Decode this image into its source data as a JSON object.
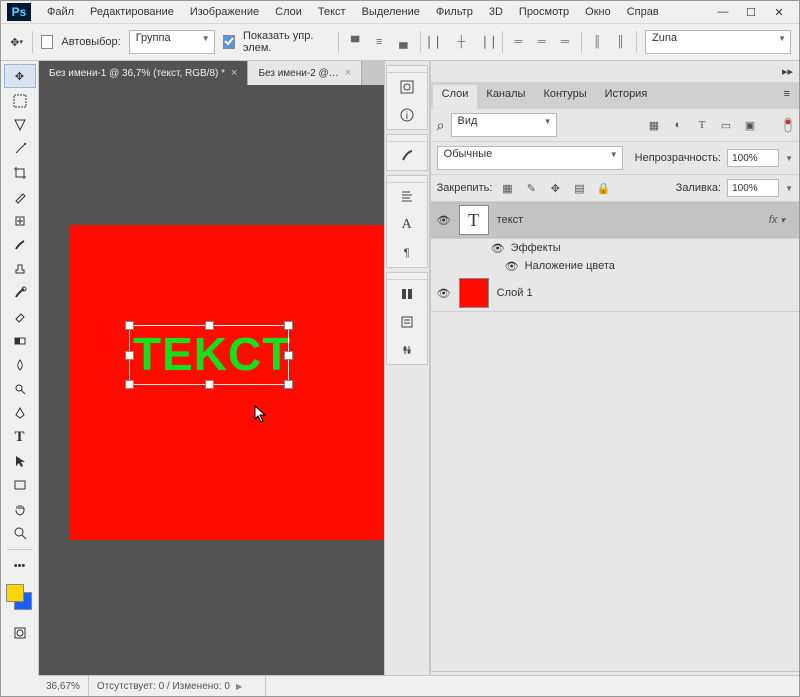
{
  "menu": [
    "Файл",
    "Редактирование",
    "Изображение",
    "Слои",
    "Текст",
    "Выделение",
    "Фильтр",
    "3D",
    "Просмотр",
    "Окно",
    "Справ"
  ],
  "options": {
    "autoselect_label": "Автовыбор:",
    "autoselect_mode": "Группа",
    "show_controls_label": "Показать упр. элем.",
    "font_preset": "Zuna"
  },
  "tabs": [
    {
      "label": "Без имени-1 @ 36,7% (текст, RGB/8) *",
      "active": true
    },
    {
      "label": "Без имени-2 @…",
      "active": false
    }
  ],
  "canvas": {
    "bg_color": "#ff0b00",
    "text": "TEKCT",
    "text_color": "#15e01b"
  },
  "status": {
    "zoom": "36,67%",
    "info": "Отсутствует: 0 / Изменено: 0"
  },
  "panel": {
    "tabs": [
      "Слои",
      "Каналы",
      "Контуры",
      "История"
    ],
    "filter_kind": "Вид",
    "blend_mode": "Обычные",
    "opacity_label": "Непрозрачность:",
    "opacity_value": "100%",
    "lock_label": "Закрепить:",
    "fill_label": "Заливка:",
    "fill_value": "100%",
    "layers": [
      {
        "name": "текст",
        "type": "text",
        "selected": true,
        "fx": [
          "Эффекты",
          "Наложение цвета"
        ]
      },
      {
        "name": "Слой 1",
        "type": "raster",
        "color": "#ff0b00"
      }
    ],
    "search_glyph": "⌕"
  },
  "swatches": {
    "fg": "#ffd400",
    "bg": "#1560ff"
  }
}
